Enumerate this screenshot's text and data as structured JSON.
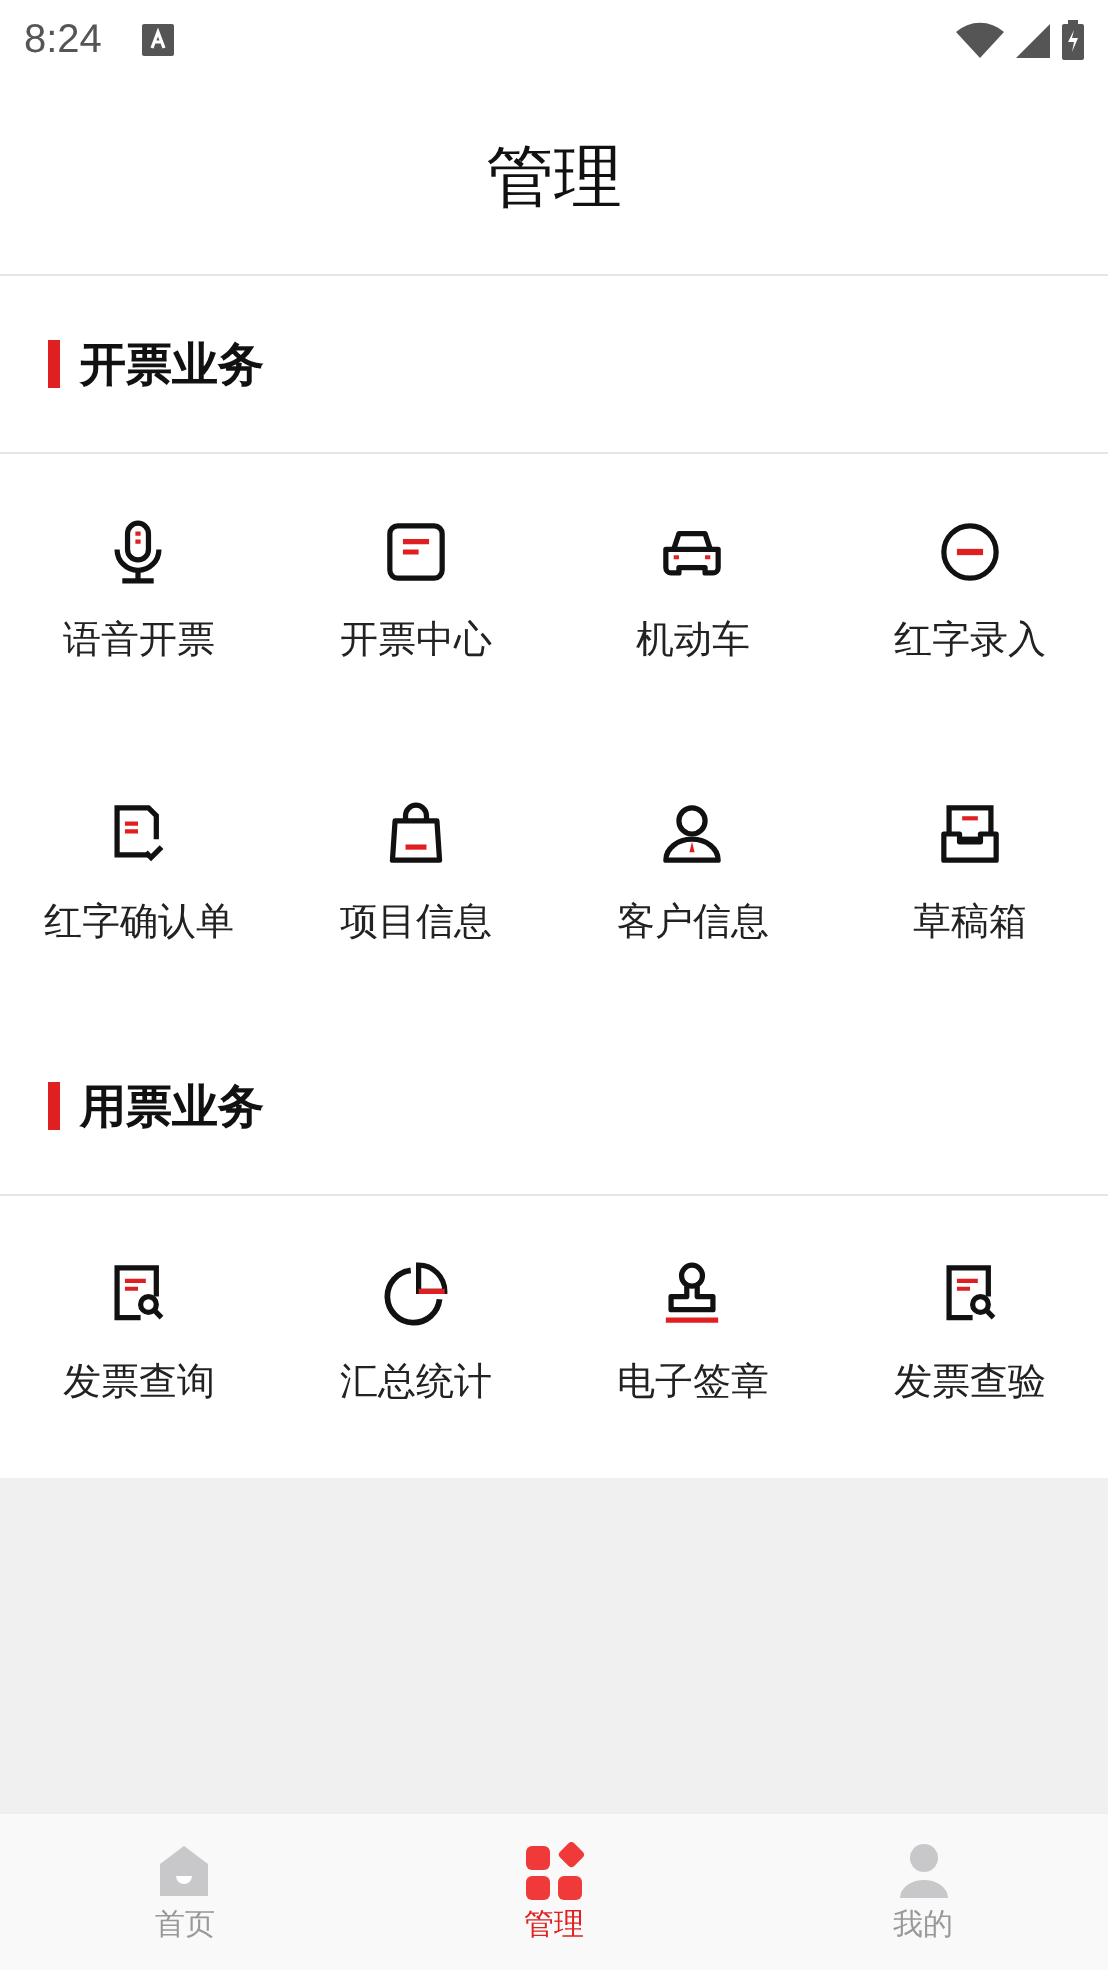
{
  "status_bar": {
    "time": "8:24"
  },
  "header": {
    "title": "管理"
  },
  "sections": [
    {
      "title": "开票业务",
      "items": [
        {
          "label": "语音开票"
        },
        {
          "label": "开票中心"
        },
        {
          "label": "机动车"
        },
        {
          "label": "红字录入"
        },
        {
          "label": "红字确认单"
        },
        {
          "label": "项目信息"
        },
        {
          "label": "客户信息"
        },
        {
          "label": "草稿箱"
        }
      ]
    },
    {
      "title": "用票业务",
      "items": [
        {
          "label": "发票查询"
        },
        {
          "label": "汇总统计"
        },
        {
          "label": "电子签章"
        },
        {
          "label": "发票查验"
        }
      ]
    }
  ],
  "tab_bar": [
    {
      "label": "首页",
      "selected": false
    },
    {
      "label": "管理",
      "selected": true
    },
    {
      "label": "我的",
      "selected": false
    }
  ]
}
